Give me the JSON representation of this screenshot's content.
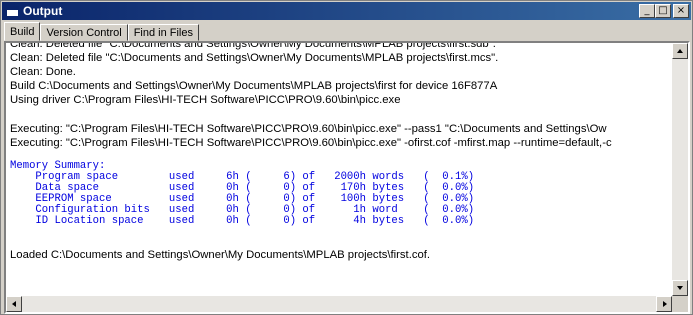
{
  "window": {
    "title": "Output",
    "controls": [
      "_",
      "□",
      "×"
    ]
  },
  "tabs": [
    {
      "label": "Build",
      "active": true
    },
    {
      "label": "Version Control",
      "active": false
    },
    {
      "label": "Find in Files",
      "active": false
    }
  ],
  "output": {
    "lines": [
      "Clean: Deleted file \"C:\\Documents and Settings\\Owner\\My Documents\\MPLAB projects\\first.sdb\".",
      "Clean: Deleted file \"C:\\Documents and Settings\\Owner\\My Documents\\MPLAB projects\\first.mcs\".",
      "Clean: Done.",
      "Build C:\\Documents and Settings\\Owner\\My Documents\\MPLAB projects\\first for device 16F877A",
      "Using driver C:\\Program Files\\HI-TECH Software\\PICC\\PRO\\9.60\\bin\\picc.exe",
      "",
      "Executing: \"C:\\Program Files\\HI-TECH Software\\PICC\\PRO\\9.60\\bin\\picc.exe\" --pass1 \"C:\\Documents and Settings\\Ow",
      "Executing: \"C:\\Program Files\\HI-TECH Software\\PICC\\PRO\\9.60\\bin\\picc.exe\" -ofirst.cof -mfirst.map --runtime=default,-c"
    ],
    "memory_summary": [
      "Memory Summary:",
      "    Program space        used     6h (     6) of   2000h words   (  0.1%)",
      "    Data space           used     0h (     0) of    170h bytes   (  0.0%)",
      "    EEPROM space         used     0h (     0) of    100h bytes   (  0.0%)",
      "    Configuration bits   used     0h (     0) of      1h word    (  0.0%)",
      "    ID Location space    used     0h (     0) of      4h bytes   (  0.0%)"
    ],
    "final_line": "Loaded C:\\Documents and Settings\\Owner\\My Documents\\MPLAB projects\\first.cof."
  },
  "colors": {
    "title_gradient_start": "#0a246a",
    "title_gradient_end": "#3a6ea5",
    "memory_text": "#0000e0"
  }
}
